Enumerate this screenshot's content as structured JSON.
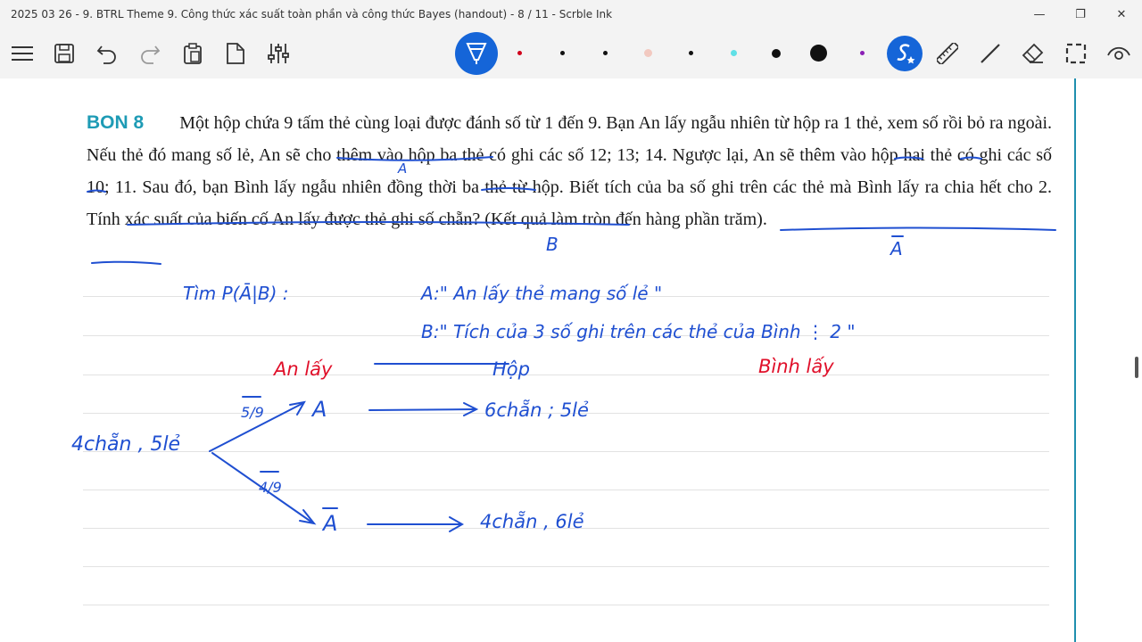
{
  "window": {
    "title": "2025 03 26 - 9. BTRL Theme 9. Công thức xác suất toàn phần và công thức Bayes (handout) - 8 / 11 - Scrble Ink",
    "minimize": "—",
    "restore": "❐",
    "close": "✕"
  },
  "toolbar": {
    "icons": [
      "menu-icon",
      "save-icon",
      "undo-icon",
      "redo-icon",
      "clipboard-icon",
      "new-page-icon",
      "settings-sliders-icon",
      "pen-tool-icon",
      "smart-ink-icon",
      "ruler-icon",
      "line-tool-icon",
      "eraser-icon",
      "lasso-select-icon",
      "view-icon"
    ],
    "pen_colors": [
      "#d0021b",
      "#111111",
      "#111111",
      "#f2c9c0",
      "#111111",
      "#5fe0e6",
      "#111111",
      "#111111",
      "#8a1fb5"
    ],
    "accent": "#1565d8"
  },
  "problem": {
    "label": "BON 8",
    "text": "Một hộp chứa 9 tấm thẻ cùng loại được đánh số từ 1 đến 9. Bạn An lấy ngẫu nhiên từ hộp ra 1 thẻ, xem số rồi bỏ ra ngoài. Nếu thẻ đó mang số lẻ, An sẽ cho thêm vào hộp ba thẻ có ghi các số 12; 13; 14. Ngược lại, An sẽ thêm vào hộp hai thẻ có ghi các số 10; 11. Sau đó, bạn Bình lấy ngẫu nhiên đồng thời ba thẻ từ hộp. Biết tích của ba số ghi trên các thẻ mà Bình lấy ra chia hết cho 2. Tính xác suất của biến cố An lấy được thẻ ghi số chẵn? (Kết quả làm tròn đến hàng phần trăm)."
  },
  "handwriting": {
    "label_a": "A",
    "label_b": "B",
    "label_abar": "A",
    "find": "Tìm   P(Ā|B)   :",
    "def_a": "A:\" An lấy thẻ mang số lẻ \"",
    "def_b": "B:\" Tích của 3 số ghi trên các thẻ của Bình ⋮ 2 \"",
    "an_lay": "An lấy",
    "hop": "Hộp",
    "binh_lay": "Bình lấy",
    "start": "4chẵn , 5lẻ",
    "prob_a": "5/9",
    "prob_abar": "4/9",
    "node_a": "A",
    "node_abar": "A",
    "result_a": "6chẵn ; 5lẻ",
    "result_abar": "4chẵn , 6lẻ",
    "ink_blue": "#1f4fd1",
    "ink_red": "#e0102a"
  }
}
